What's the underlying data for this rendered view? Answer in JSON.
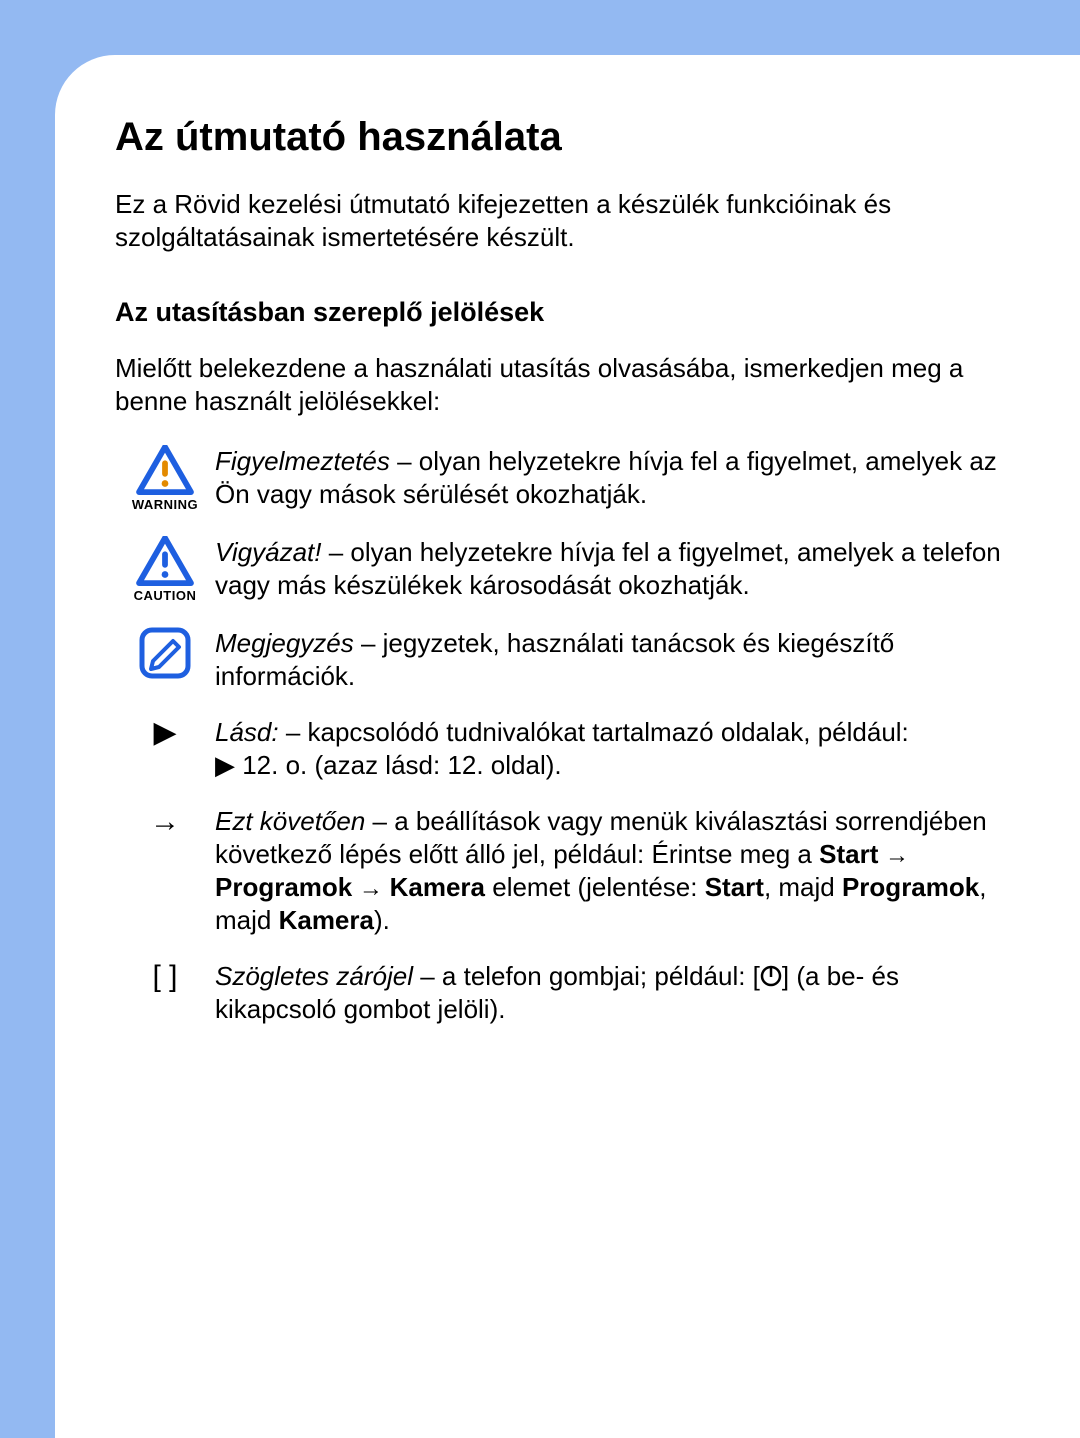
{
  "title": "Az útmutató használata",
  "intro": "Ez a Rövid kezelési útmutató kifejezetten a készülék funkcióinak és szolgáltatásainak ismertetésére készült.",
  "section_heading": "Az utasításban szereplő jelölések",
  "lead": "Mielőtt belekezdene a használati utasítás olvasásába, ismerkedjen meg a benne használt jelölésekkel:",
  "items": {
    "warning": {
      "label": "WARNING",
      "term": "Figyelmeztetés",
      "desc": " – olyan helyzetekre hívja fel a figyelmet, amelyek az Ön vagy mások sérülését okozhatják."
    },
    "caution": {
      "label": "CAUTION",
      "term": "Vigyázat!",
      "desc": " – olyan helyzetekre hívja fel a figyelmet, amelyek a telefon vagy más készülékek károsodását okozhatják."
    },
    "note": {
      "term": "Megjegyzés",
      "desc": " – jegyzetek, használati tanácsok és kiegészítő információk."
    },
    "refer": {
      "symbol": "▶",
      "term": "Lásd:",
      "desc": " – kapcsolódó tudnivalókat tartalmazó oldalak, például: ",
      "example": "▶ 12. o. (azaz lásd: 12. oldal)."
    },
    "then": {
      "symbol": "→",
      "term": "Ezt követően",
      "pre": " – a beállítások vagy menük kiválasztási sorrendjében következő lépés előtt álló jel, például: Érintse meg a ",
      "b1": "Start",
      "arrow": " → ",
      "b2": "Programok",
      "b3": "Kamera",
      "mid1": " elemet (jelentése: ",
      "mid2": ", majd ",
      "mid3": ", majd ",
      "b4": "Start",
      "b5": "Programok",
      "b6": "Kamera",
      "end": ")."
    },
    "bracket": {
      "symbol": "[    ]",
      "term": "Szögletes zárójel",
      "pre": " – a telefon gombjai; például: [",
      "post": "] (a be- és kikapcsoló gombot jelöli)."
    }
  }
}
